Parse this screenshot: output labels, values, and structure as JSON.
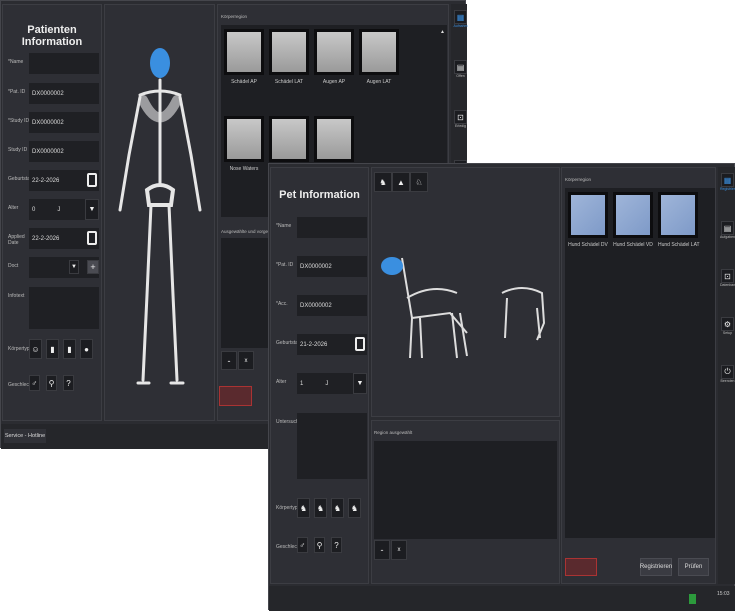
{
  "human": {
    "title": "Patienten Information",
    "fields": [
      {
        "label": "*Name",
        "value": ""
      },
      {
        "label": "*Pat. ID",
        "value": "DX0000002"
      },
      {
        "label": "*Study ID",
        "value": "DX0000002"
      },
      {
        "label": "Study ID",
        "value": "DX0000002"
      },
      {
        "label": "Geburtstag",
        "value": "22-2-2026"
      },
      {
        "label": "Alter",
        "value": "0",
        "unit": "J"
      },
      {
        "label": "Applied Date",
        "value": "22-2-2026"
      },
      {
        "label": "Doct",
        "value": ""
      },
      {
        "label": "Infotext",
        "value": ""
      }
    ],
    "koerpertyp_label": "Körpertyp",
    "geschlecht_label": "Geschlecht",
    "gender_icons": [
      "♂",
      "⚲",
      "?"
    ],
    "region_label": "Körperregion",
    "thumbs": [
      "Schädel AP",
      "Schädel LAT",
      "Augen AP",
      "Augen LAT",
      "Nose Waters",
      "",
      ""
    ],
    "selected_label": "Ausgewählte und vorgemerkte U",
    "minus": "-",
    "x": "x",
    "footer": "Service - Hotline",
    "sidebar": [
      "Aufnahm",
      "Offen",
      "Erledig",
      ""
    ],
    "highlight_color": "#3a8fe0"
  },
  "pet": {
    "title": "Pet Information",
    "fields": [
      {
        "label": "*Name",
        "value": ""
      },
      {
        "label": "*Pat. ID",
        "value": "DX0000002"
      },
      {
        "label": "*Acc.",
        "value": "DX0000002"
      },
      {
        "label": "Geburtstag",
        "value": "21-2-2026"
      },
      {
        "label": "Alter",
        "value": "1",
        "unit": "J"
      },
      {
        "label": "Untersuchun",
        "value": ""
      }
    ],
    "koerpertyp_label": "Körpertyp",
    "geschlecht_label": "Geschlecht",
    "gender_icons": [
      "♂",
      "⚲",
      "?"
    ],
    "region_selected_label": "Region ausgewählt",
    "minus": "-",
    "x": "x",
    "region_label": "Körperregion",
    "thumbs": [
      "Hund Schädel DV",
      "Hund Schädel VD",
      "Hund Schädel LAT"
    ],
    "register": "Registrieren",
    "check": "Prüfen",
    "sidebar": [
      "Registrier",
      "Aufgaben",
      "Datenban",
      "Setup",
      "Beenden"
    ],
    "time": "15:03"
  }
}
